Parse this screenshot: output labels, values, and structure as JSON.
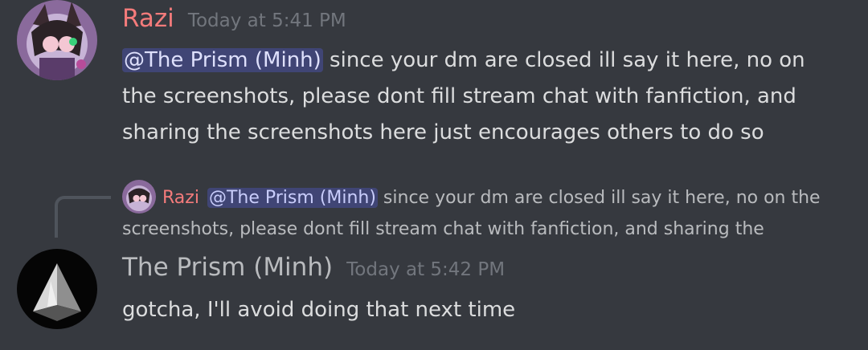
{
  "messages": [
    {
      "author": "Razi",
      "timestamp": "Today at 5:41 PM",
      "mention": "@The Prism (Minh)",
      "text": " since your dm are closed ill say it here, no on the screenshots, please dont fill stream chat with fanfiction, and sharing the screenshots here just encourages others to do so",
      "author_color": "#f47b7b"
    },
    {
      "author": "The Prism (Minh)",
      "timestamp": "Today at 5:42 PM",
      "text": "gotcha, I'll avoid doing that next time",
      "author_color": "#b9bbbe",
      "reply": {
        "author": "Razi",
        "mention": "@The Prism (Minh)",
        "text": " since your dm are closed ill say it here, no on the screenshots, please dont fill stream chat with fanfiction, and sharing the"
      }
    }
  ],
  "icons": {
    "razi_avatar": "avatar-razi-icon",
    "prism_avatar": "avatar-prism-icon"
  },
  "colors": {
    "background": "#36393f",
    "mention_bg": "rgba(88,101,242,0.30)",
    "timestamp": "#72767d"
  }
}
